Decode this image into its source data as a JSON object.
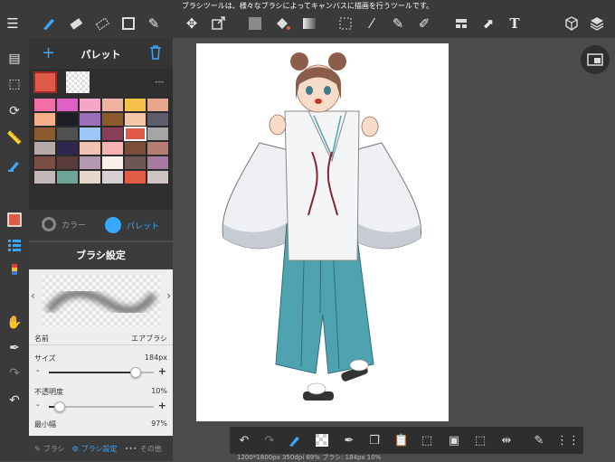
{
  "status_message": "ブラシツールは、様々なブラシによってキャンバスに描画を行うツールです。",
  "palette": {
    "title": "パレット",
    "add_icon": "plus-icon",
    "delete_icon": "trash-icon",
    "current_color": "#e05a4a",
    "menu_text": "---",
    "tab_color": "カラー",
    "tab_palette": "パレット",
    "swatches": [
      "#f26fa6",
      "#e060c7",
      "#f4a6c8",
      "#f0b3a0",
      "#f5c148",
      "#e8a68c",
      "#f5b08a",
      "#1d1d25",
      "#9a6fb7",
      "#8a5a2c",
      "#f7c6a6",
      "#5d5d6c",
      "#8b5a30",
      "#505050",
      "#9ec7f7",
      "#8b3d58",
      "#e05a4a",
      "#a5a5a8",
      "#b8a9a9",
      "#2f2750",
      "#f0c4b4",
      "#f3b3b3",
      "#7a4e38",
      "#b47e74",
      "#7a4e46",
      "#5a3d3a",
      "#b49ab0",
      "#f7efe8",
      "#6d5656",
      "#a67aa0",
      "#c2b8b8",
      "#6ea596",
      "#e5d8cc",
      "#d7d0d0",
      "#e25c47",
      "#cfc4c4"
    ]
  },
  "brush": {
    "title": "ブラシ設定",
    "name_label": "名前",
    "name_value": "エアブラシ",
    "size_label": "サイズ",
    "size_value": "184px",
    "size_fraction": 0.83,
    "opacity_label": "不透明度",
    "opacity_value": "10%",
    "opacity_fraction": 0.1,
    "minwidth_label": "最小幅",
    "minwidth_value": "97%",
    "tab_brush": "ブラシ",
    "tab_settings": "ブラシ設定",
    "tab_other": "その他"
  },
  "canvas_info": "1200*1800px 350dpi 69% ブラシ: 184px 10%"
}
